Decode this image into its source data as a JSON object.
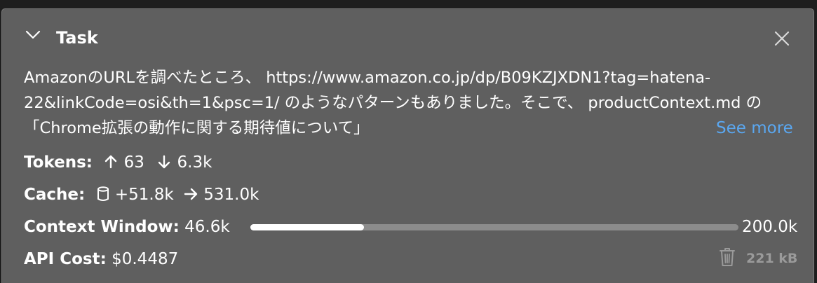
{
  "task": {
    "title": "Task",
    "text": "AmazonのURLを調べたところ、 https://www.amazon.co.jp/dp/B09KZJXDN1?tag=hatena-22&linkCode=osi&th=1&psc=1/ のようなパターンもありました。そこで、 productContext.md の 「Chrome拡張の動作に関する期待値について」",
    "see_more": "See more"
  },
  "tokens": {
    "label": "Tokens:",
    "up": "63",
    "down": "6.3k"
  },
  "cache": {
    "label": "Cache:",
    "write": "+51.8k",
    "read": "531.0k"
  },
  "context_window": {
    "label": "Context Window:",
    "used": "46.6k",
    "max": "200.0k",
    "used_fraction": 0.233
  },
  "api_cost": {
    "label": "API Cost:",
    "value": "$0.4487"
  },
  "storage": {
    "size": "221 kB"
  },
  "icons": {
    "collapse": "chevron-down-icon",
    "close": "close-icon",
    "up": "arrow-up-icon",
    "down": "arrow-down-icon",
    "cache": "database-icon",
    "right": "arrow-right-icon",
    "delete": "trash-icon"
  },
  "colors": {
    "panel": "#5f5f5f",
    "link": "#5aa7f0",
    "bar_track": "#8c8c8c",
    "bar_fill": "#ffffff",
    "muted": "#9a9a9a"
  }
}
